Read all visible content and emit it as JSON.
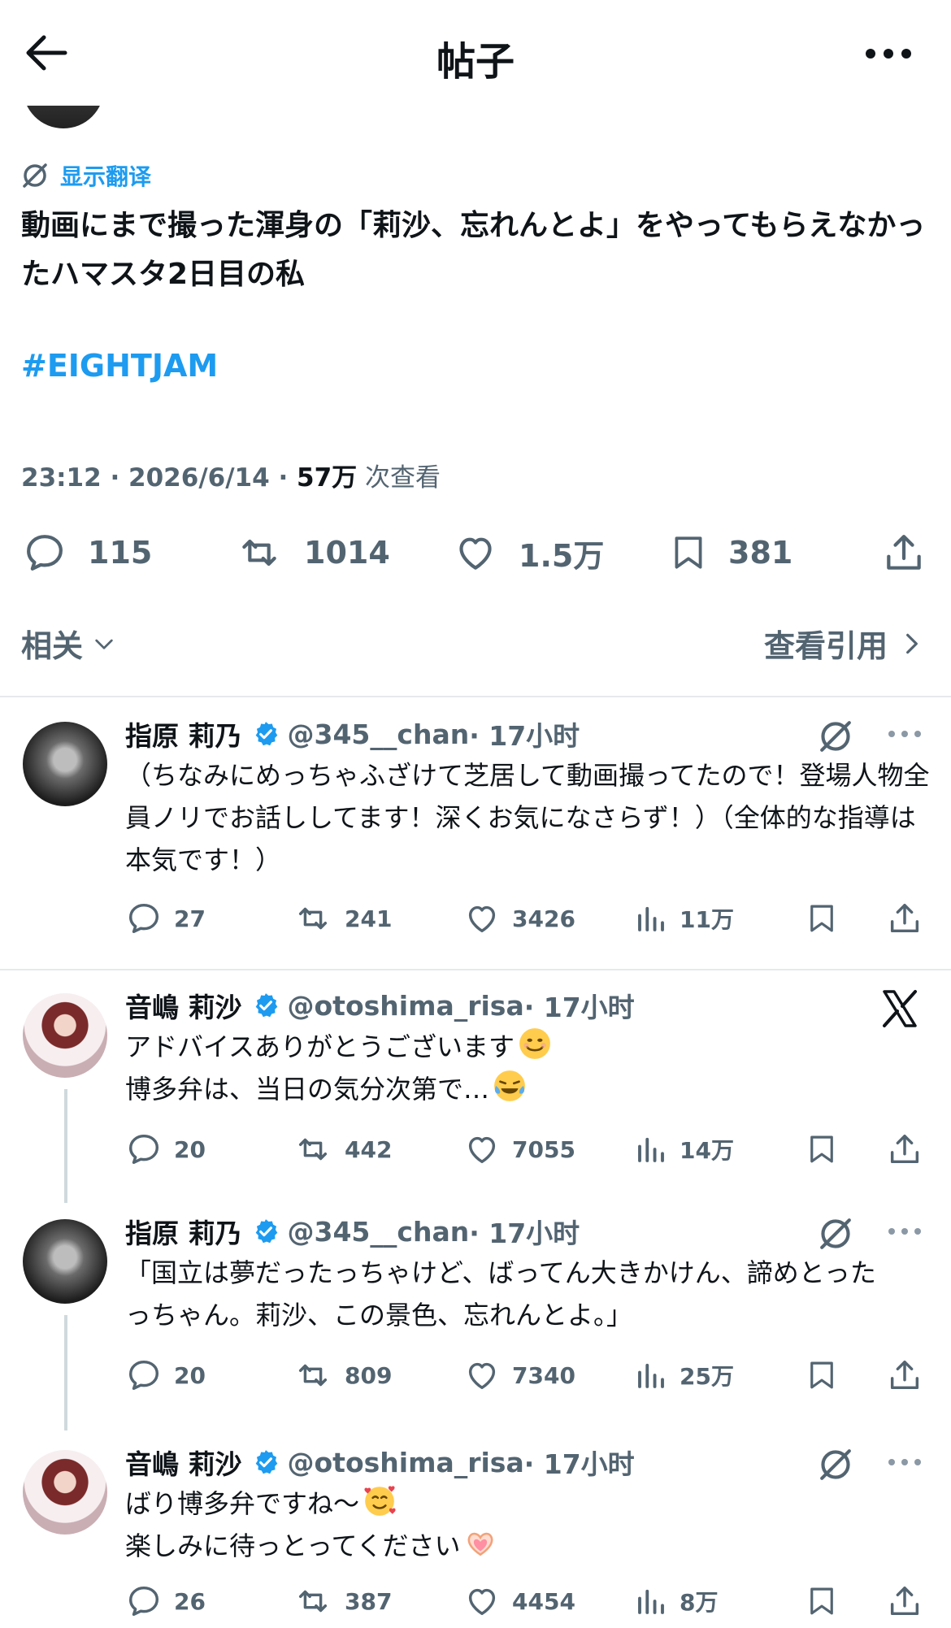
{
  "header": {
    "title": "帖子"
  },
  "post": {
    "handle_partial": "@345__chan",
    "translate_label": "显示翻译",
    "text": "動画にまで撮った渾身の「莉沙、忘れんとよ」をやってもらえなかったハマスタ2日目の私",
    "hashtag": "#EIGHTJAM",
    "time": "23:12 · 2026/6/14 · ",
    "views": "57万",
    "views_label": " 次查看",
    "stats": {
      "replies": "115",
      "reposts": "1014",
      "likes": "1.5万",
      "bookmarks": "381"
    },
    "related_label": "相关",
    "quotes_label": "查看引用"
  },
  "replies": [
    {
      "name": "指原 莉乃",
      "handle": "@345__chan",
      "time": " · 17小时",
      "text": "（ちなみにめっちゃふざけて芝居して動画撮ってたので！登場人物全員ノリでお話ししてます！深くお気になさらず！）（全体的な指導は本気です！）",
      "replies": "27",
      "reposts": "241",
      "likes": "3426",
      "views": "11万"
    },
    {
      "name": "音嶋 莉沙",
      "handle": "@otoshima_risa",
      "time": " · 17小时",
      "line1": "アドバイスありがとうございます",
      "line2": "博多弁は、当日の気分次第で…",
      "replies": "20",
      "reposts": "442",
      "likes": "7055",
      "views": "14万"
    },
    {
      "name": "指原 莉乃",
      "handle": "@345__chan",
      "time": " · 17小时",
      "text": "「国立は夢だったっちゃけど、ばってん大きかけん、諦めとったっちゃん。莉沙、この景色、忘れんとよ。」",
      "replies": "20",
      "reposts": "809",
      "likes": "7340",
      "views": "25万"
    },
    {
      "name": "音嶋 莉沙",
      "handle": "@otoshima_risa",
      "time": " · 17小时",
      "line1": "ばり博多弁ですね～",
      "line2": "楽しみに待っとってください",
      "replies": "26",
      "reposts": "387",
      "likes": "4454",
      "views": "8万"
    }
  ],
  "colors": {
    "accent": "#1d9bf0",
    "muted": "#536471",
    "text": "#0f1419"
  },
  "icons": [
    "back-arrow-icon",
    "more-icon",
    "translate-icon",
    "reply-icon",
    "repost-icon",
    "like-icon",
    "bookmark-icon",
    "share-icon",
    "views-icon",
    "verified-icon",
    "grok-icon",
    "x-logo-icon"
  ]
}
